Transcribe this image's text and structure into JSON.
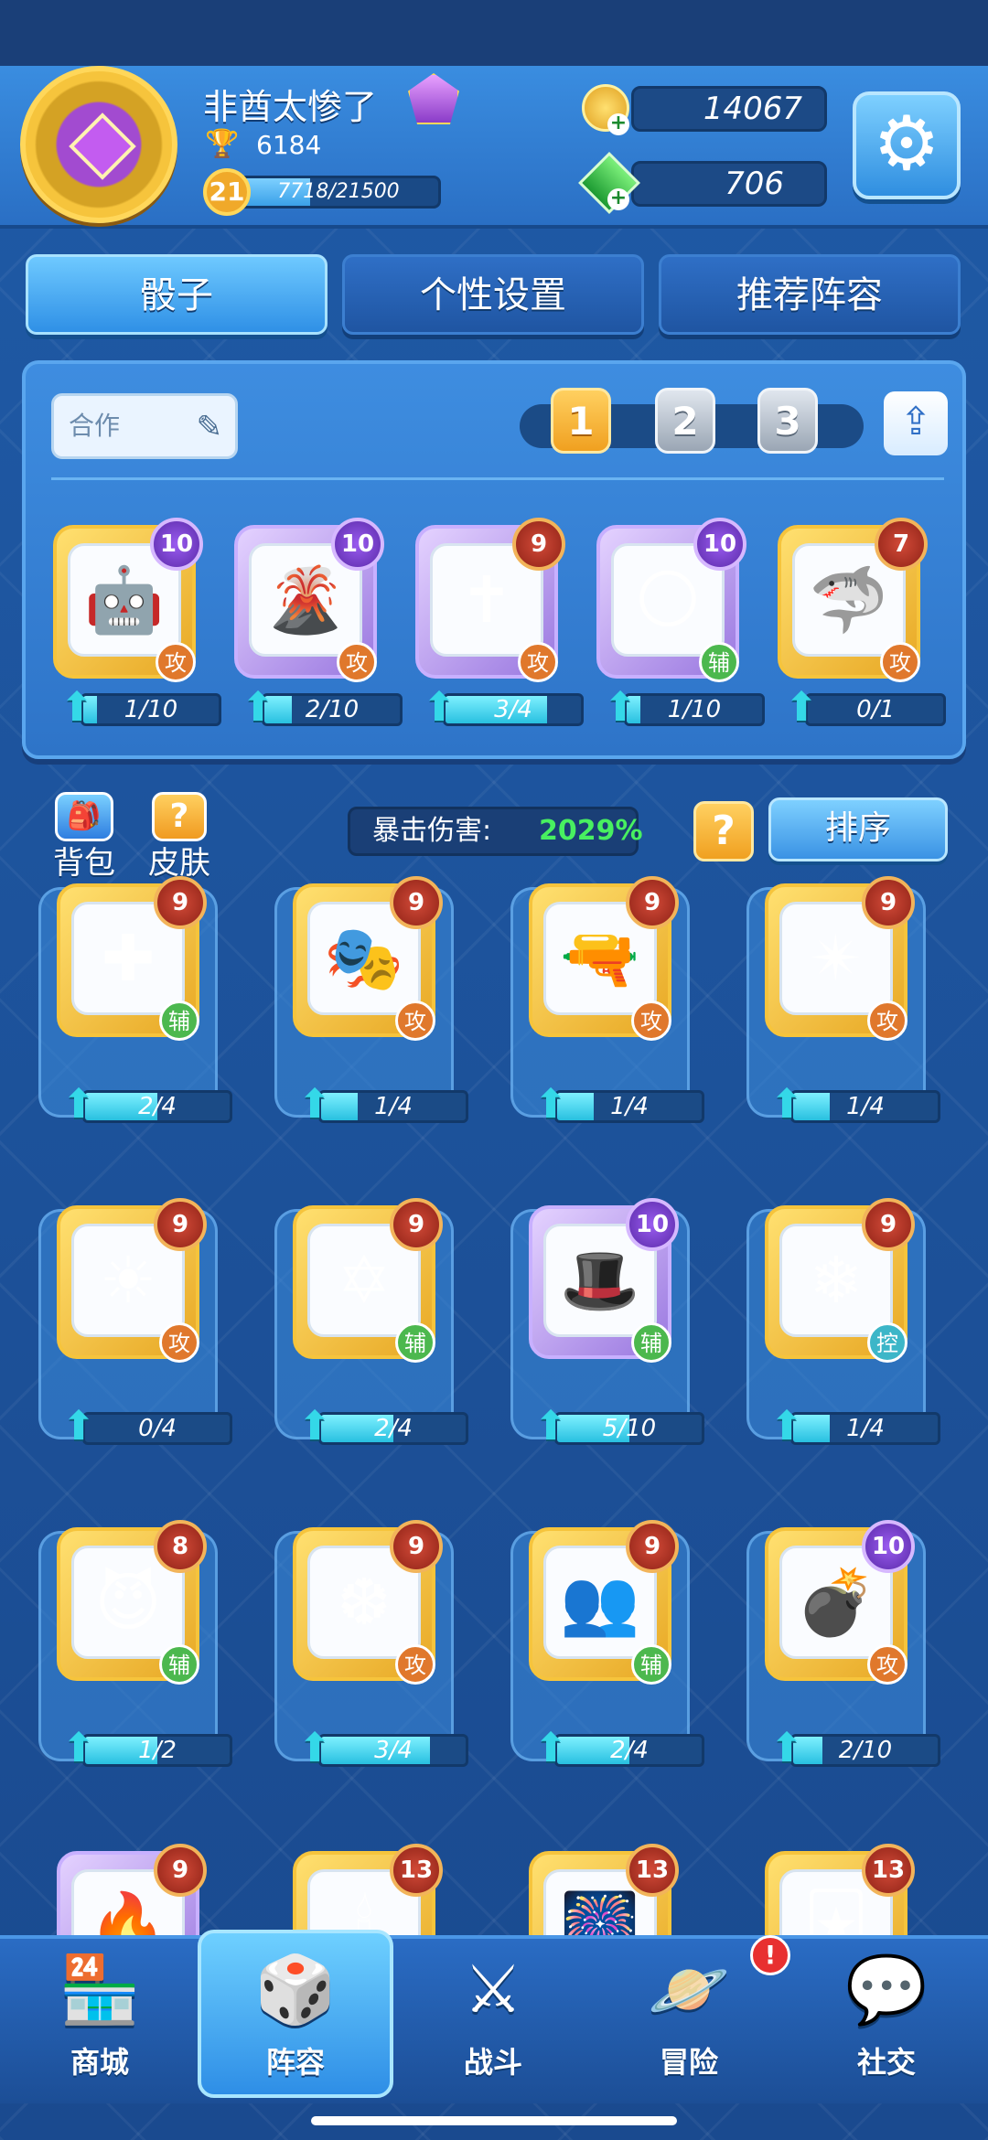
{
  "player": {
    "name": "非酋太惨了",
    "trophies": "6184",
    "level": "21",
    "xp_text": "7718/21500",
    "xp_fraction": 0.359
  },
  "currency": {
    "coins": "14067",
    "gems": "706"
  },
  "tabs": [
    {
      "label": "骰子"
    },
    {
      "label": "个性设置"
    },
    {
      "label": "推荐阵容"
    }
  ],
  "deck": {
    "name": "合作",
    "slots": [
      "1",
      "2",
      "3"
    ],
    "active_slot": "1",
    "dice": [
      {
        "icon": "robot-icon",
        "emoji": "🤖",
        "level": "10",
        "type": "攻",
        "progress": "1/10",
        "frac": 0.1,
        "frame": "gold",
        "badge": "purple"
      },
      {
        "icon": "volcano-icon",
        "emoji": "🌋",
        "level": "10",
        "type": "攻",
        "progress": "2/10",
        "frac": 0.2,
        "frame": "purple",
        "badge": "purple"
      },
      {
        "icon": "holy-cross-icon",
        "emoji": "✝",
        "level": "9",
        "type": "攻",
        "progress": "3/4",
        "frac": 0.75,
        "frame": "purple",
        "badge": "red"
      },
      {
        "icon": "moon-icon",
        "emoji": "🌕",
        "level": "10",
        "type": "辅",
        "progress": "1/10",
        "frac": 0.1,
        "frame": "purple",
        "badge": "purple"
      },
      {
        "icon": "shark-icon",
        "emoji": "🦈",
        "level": "7",
        "type": "攻",
        "progress": "0/1",
        "frac": 0.0,
        "frame": "gold",
        "badge": "red"
      }
    ]
  },
  "bag": {
    "label": "背包"
  },
  "skin": {
    "label": "皮肤"
  },
  "crit": {
    "label": "暴击伤害:",
    "value": "2029%"
  },
  "help_label": "?",
  "sort_label": "排序",
  "collection": [
    {
      "icon": "heal-cross-icon",
      "emoji": "✚",
      "level": "9",
      "type": "辅",
      "progress": "2/4",
      "frac": 0.5,
      "frame": "gold",
      "badge": "red"
    },
    {
      "icon": "mask-icon",
      "emoji": "🎭",
      "level": "9",
      "type": "攻",
      "progress": "1/4",
      "frac": 0.25,
      "frame": "gold",
      "badge": "red"
    },
    {
      "icon": "gun-icon",
      "emoji": "🔫",
      "level": "9",
      "type": "攻",
      "progress": "1/4",
      "frac": 0.25,
      "frame": "gold",
      "badge": "red"
    },
    {
      "icon": "shuriken-icon",
      "emoji": "✴",
      "level": "9",
      "type": "攻",
      "progress": "1/4",
      "frac": 0.25,
      "frame": "gold",
      "badge": "red"
    },
    {
      "icon": "sun-icon",
      "emoji": "☀",
      "level": "9",
      "type": "攻",
      "progress": "0/4",
      "frac": 0.0,
      "frame": "gold",
      "badge": "red"
    },
    {
      "icon": "magic-circle-icon",
      "emoji": "✡",
      "level": "9",
      "type": "辅",
      "progress": "2/4",
      "frac": 0.5,
      "frame": "gold",
      "badge": "red"
    },
    {
      "icon": "hat-icon",
      "emoji": "🎩",
      "level": "10",
      "type": "辅",
      "progress": "5/10",
      "frac": 0.5,
      "frame": "purple",
      "badge": "purple"
    },
    {
      "icon": "snowflake-icon",
      "emoji": "❄",
      "level": "9",
      "type": "控",
      "progress": "1/4",
      "frac": 0.25,
      "frame": "gold",
      "badge": "red"
    },
    {
      "icon": "demon-icon",
      "emoji": "😈",
      "level": "8",
      "type": "辅",
      "progress": "1/2",
      "frac": 0.5,
      "frame": "gold",
      "badge": "red"
    },
    {
      "icon": "ice-crystal-icon",
      "emoji": "❆",
      "level": "9",
      "type": "攻",
      "progress": "3/4",
      "frac": 0.75,
      "frame": "gold",
      "badge": "red"
    },
    {
      "icon": "twin-silhouette-icon",
      "emoji": "👥",
      "level": "9",
      "type": "辅",
      "progress": "2/4",
      "frac": 0.5,
      "frame": "gold",
      "badge": "red"
    },
    {
      "icon": "bomb-icon",
      "emoji": "💣",
      "level": "10",
      "type": "攻",
      "progress": "2/10",
      "frac": 0.2,
      "frame": "gold",
      "badge": "purple"
    },
    {
      "icon": "dice-partial-icon",
      "emoji": "🔥",
      "level": "9",
      "type": "",
      "progress": "",
      "frac": 0,
      "frame": "purple",
      "badge": "red"
    },
    {
      "icon": "candle-icon",
      "emoji": "🕯",
      "level": "13",
      "type": "",
      "progress": "",
      "frac": 0,
      "frame": "gold",
      "badge": "red"
    },
    {
      "icon": "firework-icon",
      "emoji": "🎆",
      "level": "13",
      "type": "",
      "progress": "",
      "frac": 0,
      "frame": "gold",
      "badge": "red"
    },
    {
      "icon": "card-icon",
      "emoji": "🃏",
      "level": "13",
      "type": "",
      "progress": "",
      "frac": 0,
      "frame": "gold",
      "badge": "red"
    }
  ],
  "nav": [
    {
      "icon": "shop-icon",
      "glyph": "🏪",
      "label": "商城"
    },
    {
      "icon": "dice-icon",
      "glyph": "🎲",
      "label": "阵容"
    },
    {
      "icon": "swords-icon",
      "glyph": "⚔",
      "label": "战斗"
    },
    {
      "icon": "planet-icon",
      "glyph": "🪐",
      "label": "冒险"
    },
    {
      "icon": "chat-icon",
      "glyph": "💬",
      "label": "社交"
    }
  ],
  "nav_alert": "!"
}
